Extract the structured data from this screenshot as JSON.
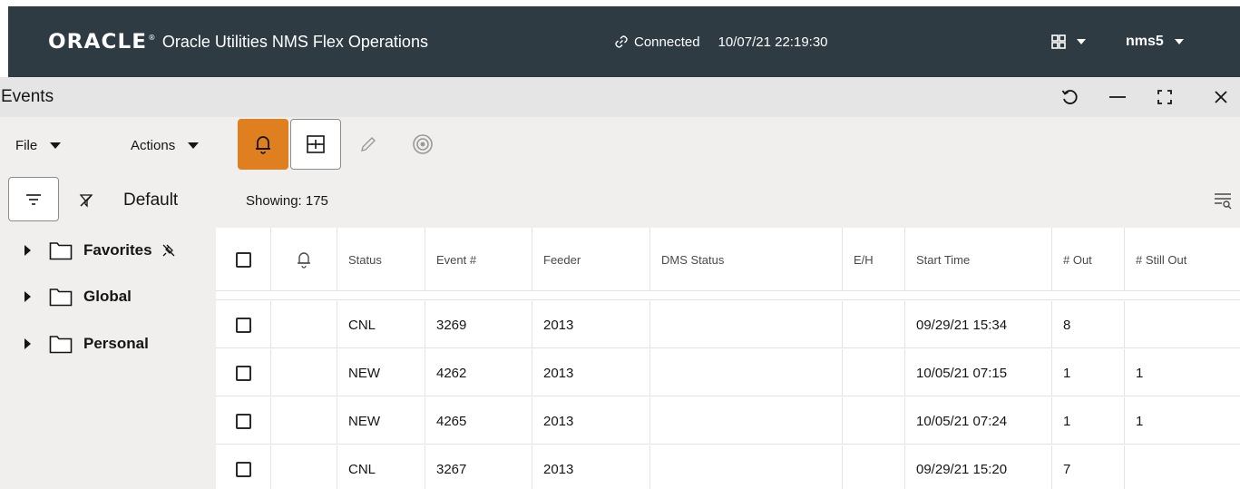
{
  "header": {
    "logo_text": "ORACLE",
    "app_title": "Oracle Utilities NMS Flex Operations",
    "connection_status": "Connected",
    "datetime": "10/07/21 22:19:30",
    "user": "nms5"
  },
  "window": {
    "title": "Events"
  },
  "toolbar": {
    "file_label": "File",
    "actions_label": "Actions"
  },
  "filter": {
    "default_label": "Default",
    "showing": "Showing: 175"
  },
  "tree": {
    "items": [
      {
        "label": "Favorites"
      },
      {
        "label": "Global"
      },
      {
        "label": "Personal"
      }
    ]
  },
  "table": {
    "columns": [
      "Status",
      "Event #",
      "Feeder",
      "DMS Status",
      "E/H",
      "Start Time",
      "# Out",
      "# Still Out"
    ],
    "rows": [
      {
        "status": "CNL",
        "event": "3269",
        "feeder": "2013",
        "dms_status": "",
        "eh": "",
        "start_time": "09/29/21 15:34",
        "out": "8",
        "still_out": ""
      },
      {
        "status": "NEW",
        "event": "4262",
        "feeder": "2013",
        "dms_status": "",
        "eh": "",
        "start_time": "10/05/21 07:15",
        "out": "1",
        "still_out": "1"
      },
      {
        "status": "NEW",
        "event": "4265",
        "feeder": "2013",
        "dms_status": "",
        "eh": "",
        "start_time": "10/05/21 07:24",
        "out": "1",
        "still_out": "1"
      },
      {
        "status": "CNL",
        "event": "3267",
        "feeder": "2013",
        "dms_status": "",
        "eh": "",
        "start_time": "09/29/21 15:20",
        "out": "7",
        "still_out": ""
      }
    ]
  },
  "colors": {
    "header_bg": "#2e3b43",
    "accent_orange": "#e07f1f",
    "panel_bg": "#f1efed",
    "titlebar_bg": "#e5e5e5"
  }
}
